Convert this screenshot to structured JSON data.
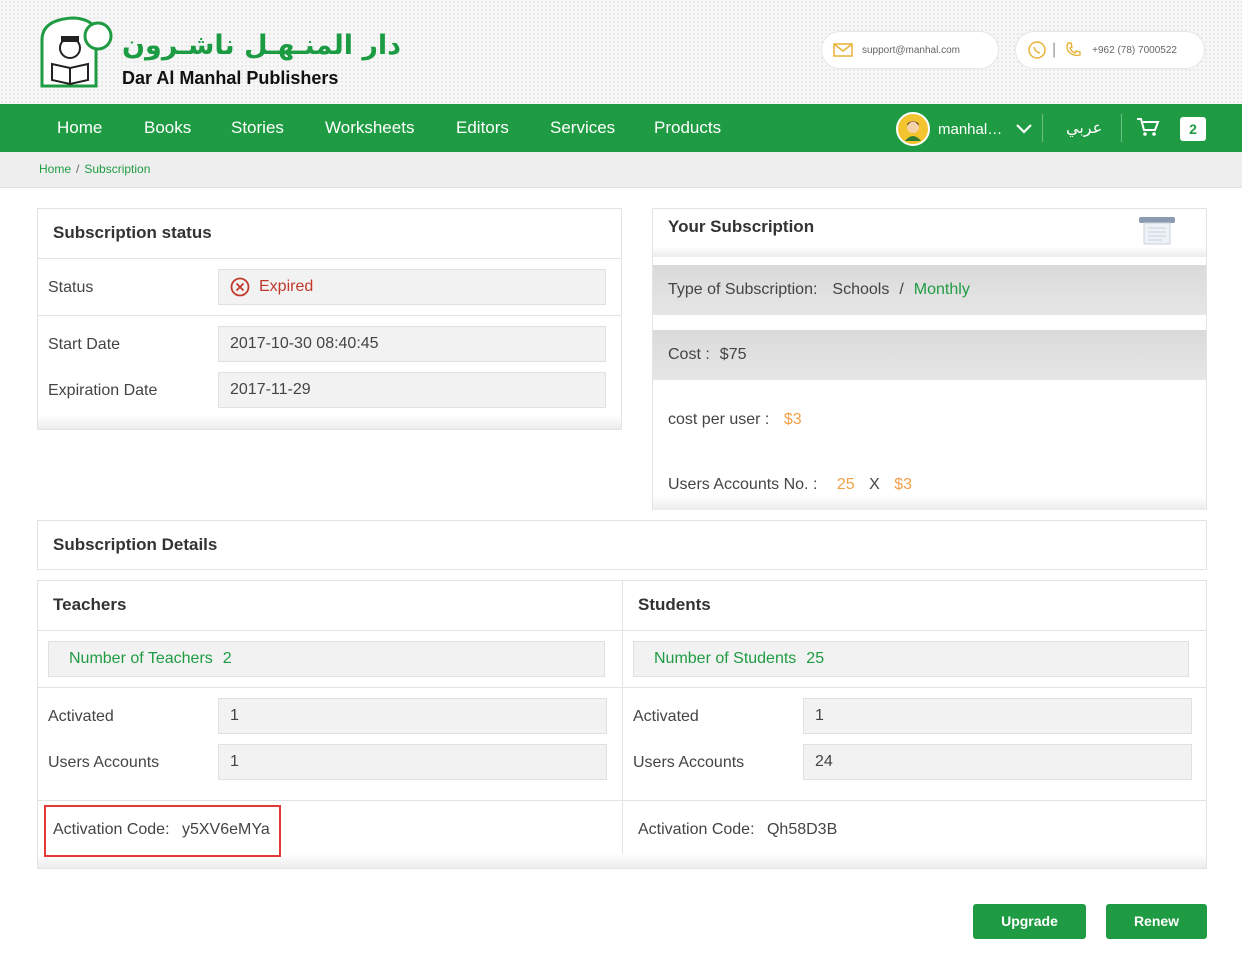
{
  "header": {
    "brand_ar": "دار المنـهـل ناشـرون",
    "brand_en": "Dar Al Manhal Publishers",
    "email": "support@manhal.com",
    "phone": "+962 (78) 7000522",
    "phone_sep": "|"
  },
  "nav": {
    "items": [
      "Home",
      "Books",
      "Stories",
      "Worksheets",
      "Editors",
      "Services",
      "Products"
    ],
    "user_name": "manhal_...",
    "lang": "عربي",
    "cart_count": "2"
  },
  "breadcrumb": {
    "home": "Home",
    "sep": "/",
    "current": "Subscription"
  },
  "status_panel": {
    "title": "Subscription status",
    "status_label": "Status",
    "status_value": "Expired",
    "start_label": "Start Date",
    "start_value": "2017-10-30 08:40:45",
    "exp_label": "Expiration Date",
    "exp_value": "2017-11-29"
  },
  "your_sub": {
    "title": "Your Subscription",
    "type_label": "Type of Subscription:",
    "type_value": "Schools",
    "type_sep": "/",
    "period": "Monthly",
    "cost_label": "Cost :",
    "cost_value": "$75",
    "per_user_label": "cost per user :",
    "per_user_value": "$3",
    "accounts_label": "Users Accounts No. :",
    "accounts_count": "25",
    "accounts_x": "X",
    "accounts_price": "$3"
  },
  "details": {
    "title": "Subscription Details",
    "teachers": {
      "title": "Teachers",
      "number_label": "Number of Teachers",
      "number_value": "2",
      "activated_label": "Activated",
      "activated_value": "1",
      "accounts_label": "Users Accounts",
      "accounts_value": "1",
      "code_label": "Activation Code:",
      "code_value": "y5XV6eMYa"
    },
    "students": {
      "title": "Students",
      "number_label": "Number of Students",
      "number_value": "25",
      "activated_label": "Activated",
      "activated_value": "1",
      "accounts_label": "Users Accounts",
      "accounts_value": "24",
      "code_label": "Activation Code:",
      "code_value": "Qh58D3B"
    }
  },
  "buttons": {
    "upgrade": "Upgrade",
    "renew": "Renew"
  },
  "colors": {
    "brand_green": "#1f9c43",
    "expired_red": "#c0392b",
    "price_orange": "#f0a04b",
    "highlight_red": "#e53935"
  },
  "icons": [
    "logo-mark-icon",
    "mail-icon",
    "whatsapp-icon",
    "phone-icon",
    "avatar-icon",
    "chevron-down-icon",
    "cart-icon",
    "expired-x-icon",
    "printer-icon"
  ]
}
